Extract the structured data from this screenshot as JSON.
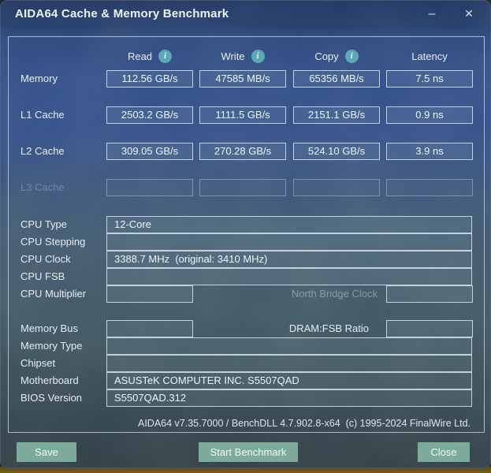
{
  "window": {
    "title": "AIDA64 Cache & Memory Benchmark",
    "controls": {
      "minimize": "–",
      "close": "✕"
    }
  },
  "icons": {
    "info": "i"
  },
  "colors": {
    "titlebar": "#1f3663",
    "button": "#7cab9c",
    "info_icon": "#5ca8b5",
    "box_border": "#dfe8ef",
    "background_top": "#32508c",
    "background_bottom": "#2f3e45",
    "bottom_strip": "#6e541a"
  },
  "benchmark_table": {
    "columns": [
      {
        "label": "Read",
        "has_info": true
      },
      {
        "label": "Write",
        "has_info": true
      },
      {
        "label": "Copy",
        "has_info": true
      },
      {
        "label": "Latency",
        "has_info": false
      }
    ],
    "rows": [
      {
        "label": "Memory",
        "enabled": true,
        "values": [
          "112.56 GB/s",
          "47585 MB/s",
          "65356 MB/s",
          "7.5 ns"
        ]
      },
      {
        "label": "L1 Cache",
        "enabled": true,
        "values": [
          "2503.2 GB/s",
          "1111.5 GB/s",
          "2151.1 GB/s",
          "0.9 ns"
        ]
      },
      {
        "label": "L2 Cache",
        "enabled": true,
        "values": [
          "309.05 GB/s",
          "270.28 GB/s",
          "524.10 GB/s",
          "3.9 ns"
        ]
      },
      {
        "label": "L3 Cache",
        "enabled": false,
        "values": [
          "",
          "",
          "",
          ""
        ]
      }
    ]
  },
  "system_info": {
    "cpu": [
      {
        "label": "CPU Type",
        "value": "12-Core"
      },
      {
        "label": "CPU Stepping",
        "value": ""
      },
      {
        "label": "CPU Clock",
        "value": "3388.7 MHz  (original: 3410 MHz)"
      },
      {
        "label": "CPU FSB",
        "value": ""
      },
      {
        "label": "CPU Multiplier",
        "value": "",
        "mid_label": "North Bridge Clock",
        "mid_disabled": true,
        "value2": ""
      }
    ],
    "memory": [
      {
        "label": "Memory Bus",
        "value": "",
        "mid_label": "DRAM:FSB Ratio",
        "mid_disabled": false,
        "value2": ""
      },
      {
        "label": "Memory Type",
        "value": ""
      },
      {
        "label": "Chipset",
        "value": ""
      },
      {
        "label": "Motherboard",
        "value": "ASUSTeK COMPUTER INC. S5507QAD"
      },
      {
        "label": "BIOS Version",
        "value": "S5507QAD.312"
      }
    ]
  },
  "footer": {
    "version_line": "AIDA64 v7.35.7000 / BenchDLL 4.7.902.8-x64  (c) 1995-2024 FinalWire Ltd."
  },
  "buttons": {
    "save": "Save",
    "start": "Start Benchmark",
    "close": "Close"
  }
}
